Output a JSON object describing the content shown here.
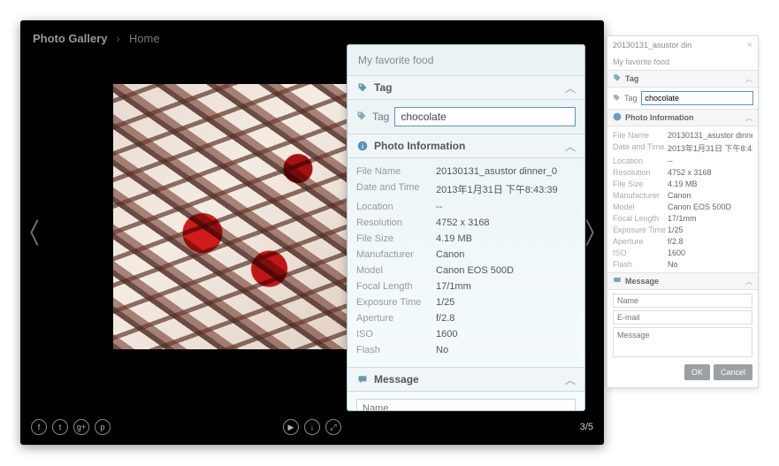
{
  "viewer": {
    "app_title": "Photo Gallery",
    "breadcrumb_sep": "›",
    "breadcrumb_item": "Home",
    "counter": "3/5"
  },
  "social": {
    "facebook": "f",
    "twitter": "t",
    "gplus": "g+",
    "pinterest": "p"
  },
  "controls": {
    "play": "▶",
    "download": "↓",
    "fullscreen": "⤢"
  },
  "panel": {
    "title": "My favorite food",
    "tag_section": "Tag",
    "tag_label": "Tag",
    "tag_value": "chocolate",
    "info_section": "Photo Information",
    "info": {
      "filename_k": "File Name",
      "filename_v": "20130131_asustor dinner_0",
      "datetime_k": "Date and Time",
      "datetime_v": "2013年1月31日 下午8:43:39",
      "location_k": "Location",
      "location_v": "--",
      "resolution_k": "Resolution",
      "resolution_v": "4752 x 3168",
      "filesize_k": "File Size",
      "filesize_v": "4.19 MB",
      "manufacturer_k": "Manufacturer",
      "manufacturer_v": "Canon",
      "model_k": "Model",
      "model_v": "Canon EOS 500D",
      "focal_k": "Focal Length",
      "focal_v": "17/1mm",
      "exposure_k": "Exposure Time",
      "exposure_v": "1/25",
      "aperture_k": "Aperture",
      "aperture_v": "f/2.8",
      "iso_k": "ISO",
      "iso_v": "1600",
      "flash_k": "Flash",
      "flash_v": "No"
    },
    "message_section": "Message",
    "name_ph": "Name",
    "email_ph": "E-mail"
  },
  "panel_sm": {
    "filename_short": "20130131_asustor din",
    "title": "My favorite food",
    "tag_section": "Tag",
    "tag_label": "Tag",
    "tag_value": "chocolate",
    "info_section": "Photo Information",
    "message_section": "Message",
    "msg_ph": "Message",
    "ok": "OK",
    "cancel": "Cancel"
  }
}
